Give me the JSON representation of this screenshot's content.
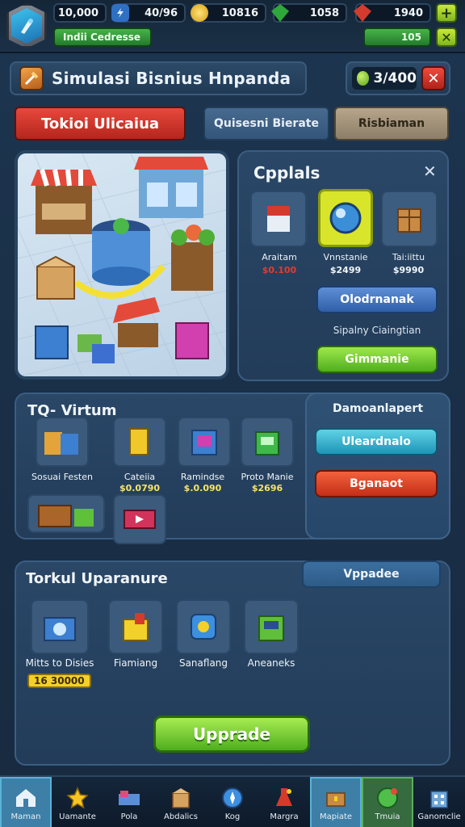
{
  "topbar": {
    "resources": [
      {
        "value": "10,000",
        "icon": "coin-stack-icon"
      },
      {
        "value": "40/96",
        "icon": "lightning-icon"
      },
      {
        "value": "10816",
        "icon": "gold-coin-icon"
      },
      {
        "value": "1058",
        "icon": "green-gem-icon"
      },
      {
        "value": "1940",
        "icon": "red-gem-icon"
      }
    ],
    "profile_label": "Indii Cedresse",
    "level_value": "105"
  },
  "header": {
    "title": "Simulasi Bisnius Hnpanda",
    "currency_value": "3/400"
  },
  "tabs": {
    "primary": "Tokioi Ulicaiua",
    "secondary": "Quisesni Bierate",
    "tertiary": "Risbiaman"
  },
  "cpanel": {
    "title": "Cpplals",
    "items": [
      {
        "label": "Araitam",
        "price": "$0.100",
        "price_color": "#e53a2c"
      },
      {
        "label": "Vnnstanie",
        "price": "$2499",
        "price_color": "#f2f6fa"
      },
      {
        "label": "Tai:iittu",
        "price": "$9990",
        "price_color": "#f2f6fa"
      }
    ],
    "blue_button": "Olodrnanak",
    "caption": "Sipalny Ciaingtian",
    "green_button": "Gimmanie"
  },
  "vpanel": {
    "title": "TQ- Virtum",
    "items": [
      {
        "label": "Sosuai Festen",
        "price": ""
      },
      {
        "label": "Cateiia",
        "price": "$0.0790"
      },
      {
        "label": "Ramindse",
        "price": "$.0.090"
      },
      {
        "label": "Proto Manie",
        "price": "$2696"
      }
    ],
    "side_title": "Damoanlapert",
    "side_cyan": "Uleardnalo",
    "side_red": "Bganaot"
  },
  "upanel": {
    "title": "Torkul Uparanure",
    "tab": "Vppadee",
    "items": [
      {
        "label": "Mitts to Disies"
      },
      {
        "label": "Fiamiang"
      },
      {
        "label": "Sanaflang"
      },
      {
        "label": "Aneaneks"
      }
    ],
    "price_badge": "16 30000",
    "upgrade_button": "Upprade"
  },
  "nav": [
    {
      "label": "Maman",
      "icon": "home-icon"
    },
    {
      "label": "Uamante",
      "icon": "star-icon"
    },
    {
      "label": "Pola",
      "icon": "bed-icon"
    },
    {
      "label": "Abdalics",
      "icon": "box-icon"
    },
    {
      "label": "Kog",
      "icon": "compass-icon"
    },
    {
      "label": "Margra",
      "icon": "flask-icon"
    },
    {
      "label": "Mapiate",
      "icon": "chest-icon"
    },
    {
      "label": "Tmuia",
      "icon": "globe-icon"
    },
    {
      "label": "Ganomclie",
      "icon": "building-icon"
    }
  ]
}
